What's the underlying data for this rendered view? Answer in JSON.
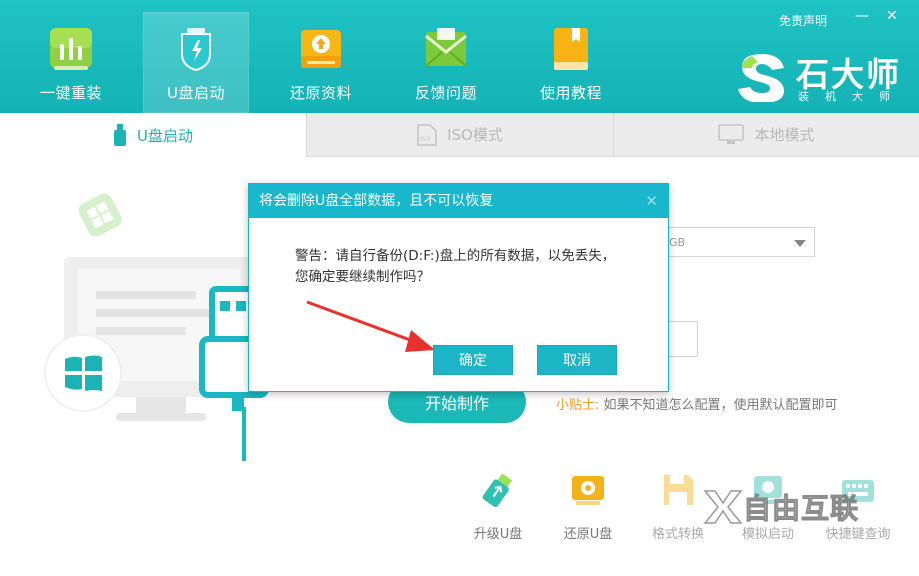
{
  "window": {
    "disclaimer": "免责声明",
    "minimize": "—",
    "close": "✕"
  },
  "nav": {
    "items": [
      {
        "label": "一键重装",
        "icon": "chart-icon"
      },
      {
        "label": "U盘启动",
        "icon": "usb-shield-icon"
      },
      {
        "label": "还原资料",
        "icon": "restore-upload-icon"
      },
      {
        "label": "反馈问题",
        "icon": "envelope-icon"
      },
      {
        "label": "使用教程",
        "icon": "book-icon"
      }
    ],
    "active_index": 1
  },
  "logo": {
    "title": "石大师",
    "subtitle": "装机大师"
  },
  "subtabs": [
    {
      "label": "U盘启动",
      "icon": "usb-drive-icon"
    },
    {
      "label": "ISO模式",
      "icon": "iso-file-icon"
    },
    {
      "label": "本地模式",
      "icon": "monitor-icon"
    }
  ],
  "main": {
    "device_select_value": "GB",
    "start_button": "开始制作",
    "tip_label": "小贴士:",
    "tip_text": "如果不知道怎么配置，使用默认配置即可"
  },
  "tools": [
    {
      "label": "升级U盘",
      "icon": "usb-upgrade-icon"
    },
    {
      "label": "还原U盘",
      "icon": "usb-restore-icon"
    },
    {
      "label": "格式转换",
      "icon": "floppy-icon"
    },
    {
      "label": "模拟启动",
      "icon": "simulate-icon"
    },
    {
      "label": "快捷键查询",
      "icon": "keyboard-icon"
    }
  ],
  "watermark": {
    "text": "自由互联"
  },
  "dialog": {
    "title": "将会删除U盘全部数据，且不可以恢复",
    "message_line1": "警告：请自行备份(D:F:)盘上的所有数据，以免丢失，",
    "message_line2": "您确定要继续制作吗？",
    "confirm": "确定",
    "cancel": "取消",
    "close": "✕"
  },
  "colors": {
    "accent": "#1bb8b8",
    "dialog_title": "#19b7cc",
    "tip_label": "#f0a030",
    "arrow": "#e8322e"
  }
}
